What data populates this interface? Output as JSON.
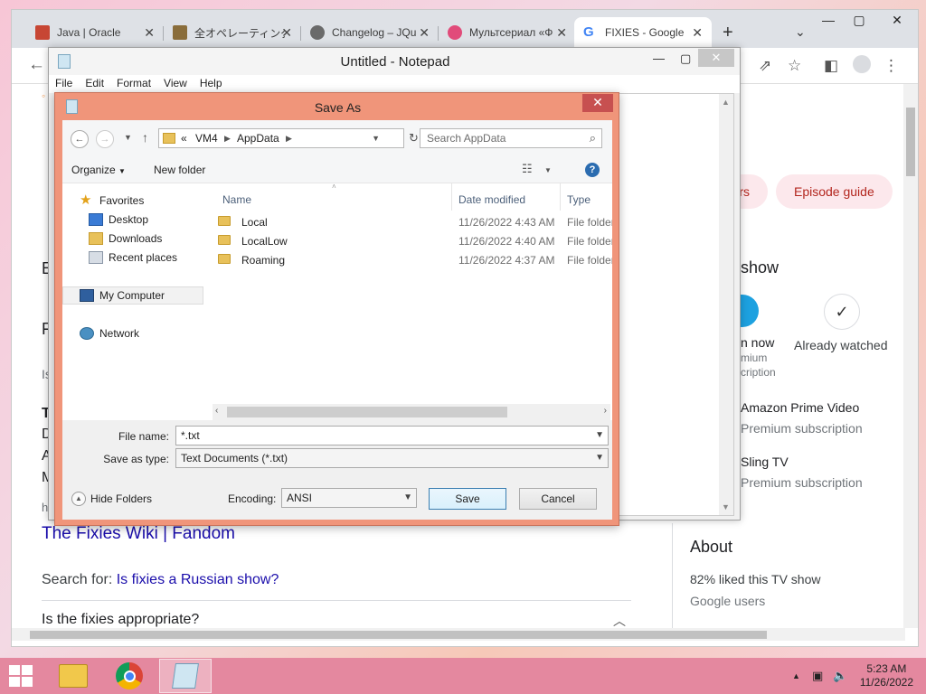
{
  "browser": {
    "tabs": [
      {
        "title": "Java | Oracle",
        "favicon_color": "#c74634"
      },
      {
        "title": "全オペレーティング",
        "favicon_color": "#8a6d3b"
      },
      {
        "title": "Changelog – JQu",
        "favicon_color": "#6a6a6a"
      },
      {
        "title": "Мультсериал «Ф",
        "favicon_color": "#e14b7a"
      },
      {
        "title": "FIXIES - Google",
        "favicon_color": "#4285f4"
      }
    ],
    "new_tab": "+",
    "tab_list": "⌄",
    "window_controls": {
      "minimize": "—",
      "maximize": "▢",
      "close": "✕"
    },
    "page": {
      "chip_partial": "rs",
      "chip_episode_guide": "Episode guide",
      "left_letters": [
        "E",
        "F",
        "Is",
        "T",
        "D",
        "A",
        "M",
        "h"
      ],
      "where_to_watch": "show",
      "watch_now_partial": "n now",
      "premium_partial": "mium",
      "subscription_partial": "cription",
      "already_watched": "Already watched",
      "providers": [
        {
          "name": "Amazon Prime Video",
          "detail": "Premium subscription"
        },
        {
          "name": "Sling TV",
          "detail": "Premium subscription"
        }
      ],
      "result_link": "The Fixies Wiki | Fandom",
      "search_for_label": "Search for:",
      "search_for_link": "Is fixies a Russian show?",
      "question": "Is the fixies appropriate?",
      "about_title": "About",
      "about_liked": "82% liked this TV show",
      "about_source": "Google users"
    }
  },
  "notepad": {
    "title": "Untitled - Notepad",
    "menu": [
      "File",
      "Edit",
      "Format",
      "View",
      "Help"
    ]
  },
  "save_as": {
    "title": "Save As",
    "close": "✕",
    "breadcrumb": {
      "prefix": "«",
      "items": [
        "VM4",
        "AppData"
      ]
    },
    "search_placeholder": "Search AppData",
    "organize": "Organize",
    "new_folder": "New folder",
    "tree": {
      "favorites": "Favorites",
      "desktop": "Desktop",
      "downloads": "Downloads",
      "recent": "Recent places",
      "computer": "My Computer",
      "network": "Network"
    },
    "columns": {
      "name": "Name",
      "date": "Date modified",
      "type": "Type"
    },
    "files": [
      {
        "name": "Local",
        "date": "11/26/2022 4:43 AM",
        "type": "File folder"
      },
      {
        "name": "LocalLow",
        "date": "11/26/2022 4:40 AM",
        "type": "File folder"
      },
      {
        "name": "Roaming",
        "date": "11/26/2022 4:37 AM",
        "type": "File folder"
      }
    ],
    "file_name_label": "File name:",
    "file_name_value": "*.txt",
    "save_type_label": "Save as type:",
    "save_type_value": "Text Documents (*.txt)",
    "hide_folders": "Hide Folders",
    "encoding_label": "Encoding:",
    "encoding_value": "ANSI",
    "save_button": "Save",
    "cancel_button": "Cancel"
  },
  "taskbar": {
    "time": "5:23 AM",
    "date": "11/26/2022"
  }
}
